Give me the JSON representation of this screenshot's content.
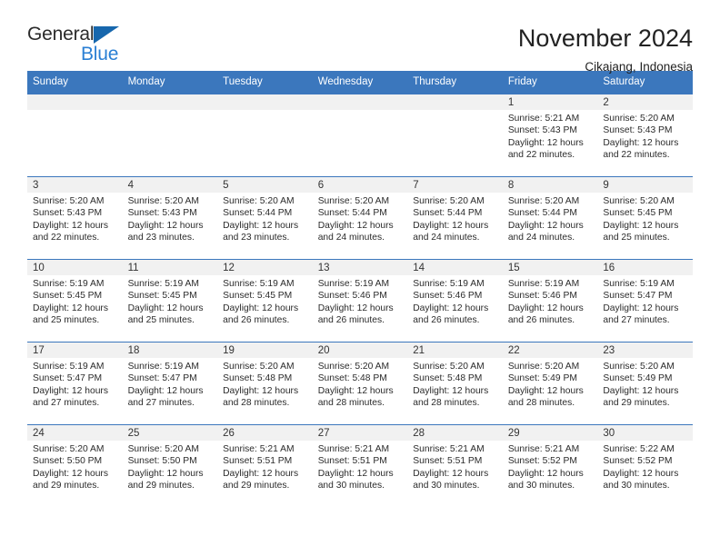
{
  "brand": {
    "name_part1": "General",
    "name_part2": "Blue",
    "triangle_icon": "triangle-icon",
    "colors": {
      "dark": "#2b2b2b",
      "blue": "#2a7fd4",
      "triangle": "#1767ad"
    }
  },
  "header": {
    "title": "November 2024",
    "location": "Cikajang, Indonesia"
  },
  "colors": {
    "header_blue": "#3b77bd",
    "daynum_band": "#f1f1f1",
    "cell_bg": "#ffffff",
    "text": "#2b2b2b"
  },
  "calendar": {
    "weekday_headers": [
      "Sunday",
      "Monday",
      "Tuesday",
      "Wednesday",
      "Thursday",
      "Friday",
      "Saturday"
    ],
    "weeks": [
      [
        {
          "empty": true,
          "day": ""
        },
        {
          "empty": true,
          "day": ""
        },
        {
          "empty": true,
          "day": ""
        },
        {
          "empty": true,
          "day": ""
        },
        {
          "empty": true,
          "day": ""
        },
        {
          "empty": false,
          "day": "1",
          "sunrise": "Sunrise: 5:21 AM",
          "sunset": "Sunset: 5:43 PM",
          "daylight1": "Daylight: 12 hours",
          "daylight2": "and 22 minutes."
        },
        {
          "empty": false,
          "day": "2",
          "sunrise": "Sunrise: 5:20 AM",
          "sunset": "Sunset: 5:43 PM",
          "daylight1": "Daylight: 12 hours",
          "daylight2": "and 22 minutes."
        }
      ],
      [
        {
          "empty": false,
          "day": "3",
          "sunrise": "Sunrise: 5:20 AM",
          "sunset": "Sunset: 5:43 PM",
          "daylight1": "Daylight: 12 hours",
          "daylight2": "and 22 minutes."
        },
        {
          "empty": false,
          "day": "4",
          "sunrise": "Sunrise: 5:20 AM",
          "sunset": "Sunset: 5:43 PM",
          "daylight1": "Daylight: 12 hours",
          "daylight2": "and 23 minutes."
        },
        {
          "empty": false,
          "day": "5",
          "sunrise": "Sunrise: 5:20 AM",
          "sunset": "Sunset: 5:44 PM",
          "daylight1": "Daylight: 12 hours",
          "daylight2": "and 23 minutes."
        },
        {
          "empty": false,
          "day": "6",
          "sunrise": "Sunrise: 5:20 AM",
          "sunset": "Sunset: 5:44 PM",
          "daylight1": "Daylight: 12 hours",
          "daylight2": "and 24 minutes."
        },
        {
          "empty": false,
          "day": "7",
          "sunrise": "Sunrise: 5:20 AM",
          "sunset": "Sunset: 5:44 PM",
          "daylight1": "Daylight: 12 hours",
          "daylight2": "and 24 minutes."
        },
        {
          "empty": false,
          "day": "8",
          "sunrise": "Sunrise: 5:20 AM",
          "sunset": "Sunset: 5:44 PM",
          "daylight1": "Daylight: 12 hours",
          "daylight2": "and 24 minutes."
        },
        {
          "empty": false,
          "day": "9",
          "sunrise": "Sunrise: 5:20 AM",
          "sunset": "Sunset: 5:45 PM",
          "daylight1": "Daylight: 12 hours",
          "daylight2": "and 25 minutes."
        }
      ],
      [
        {
          "empty": false,
          "day": "10",
          "sunrise": "Sunrise: 5:19 AM",
          "sunset": "Sunset: 5:45 PM",
          "daylight1": "Daylight: 12 hours",
          "daylight2": "and 25 minutes."
        },
        {
          "empty": false,
          "day": "11",
          "sunrise": "Sunrise: 5:19 AM",
          "sunset": "Sunset: 5:45 PM",
          "daylight1": "Daylight: 12 hours",
          "daylight2": "and 25 minutes."
        },
        {
          "empty": false,
          "day": "12",
          "sunrise": "Sunrise: 5:19 AM",
          "sunset": "Sunset: 5:45 PM",
          "daylight1": "Daylight: 12 hours",
          "daylight2": "and 26 minutes."
        },
        {
          "empty": false,
          "day": "13",
          "sunrise": "Sunrise: 5:19 AM",
          "sunset": "Sunset: 5:46 PM",
          "daylight1": "Daylight: 12 hours",
          "daylight2": "and 26 minutes."
        },
        {
          "empty": false,
          "day": "14",
          "sunrise": "Sunrise: 5:19 AM",
          "sunset": "Sunset: 5:46 PM",
          "daylight1": "Daylight: 12 hours",
          "daylight2": "and 26 minutes."
        },
        {
          "empty": false,
          "day": "15",
          "sunrise": "Sunrise: 5:19 AM",
          "sunset": "Sunset: 5:46 PM",
          "daylight1": "Daylight: 12 hours",
          "daylight2": "and 26 minutes."
        },
        {
          "empty": false,
          "day": "16",
          "sunrise": "Sunrise: 5:19 AM",
          "sunset": "Sunset: 5:47 PM",
          "daylight1": "Daylight: 12 hours",
          "daylight2": "and 27 minutes."
        }
      ],
      [
        {
          "empty": false,
          "day": "17",
          "sunrise": "Sunrise: 5:19 AM",
          "sunset": "Sunset: 5:47 PM",
          "daylight1": "Daylight: 12 hours",
          "daylight2": "and 27 minutes."
        },
        {
          "empty": false,
          "day": "18",
          "sunrise": "Sunrise: 5:19 AM",
          "sunset": "Sunset: 5:47 PM",
          "daylight1": "Daylight: 12 hours",
          "daylight2": "and 27 minutes."
        },
        {
          "empty": false,
          "day": "19",
          "sunrise": "Sunrise: 5:20 AM",
          "sunset": "Sunset: 5:48 PM",
          "daylight1": "Daylight: 12 hours",
          "daylight2": "and 28 minutes."
        },
        {
          "empty": false,
          "day": "20",
          "sunrise": "Sunrise: 5:20 AM",
          "sunset": "Sunset: 5:48 PM",
          "daylight1": "Daylight: 12 hours",
          "daylight2": "and 28 minutes."
        },
        {
          "empty": false,
          "day": "21",
          "sunrise": "Sunrise: 5:20 AM",
          "sunset": "Sunset: 5:48 PM",
          "daylight1": "Daylight: 12 hours",
          "daylight2": "and 28 minutes."
        },
        {
          "empty": false,
          "day": "22",
          "sunrise": "Sunrise: 5:20 AM",
          "sunset": "Sunset: 5:49 PM",
          "daylight1": "Daylight: 12 hours",
          "daylight2": "and 28 minutes."
        },
        {
          "empty": false,
          "day": "23",
          "sunrise": "Sunrise: 5:20 AM",
          "sunset": "Sunset: 5:49 PM",
          "daylight1": "Daylight: 12 hours",
          "daylight2": "and 29 minutes."
        }
      ],
      [
        {
          "empty": false,
          "day": "24",
          "sunrise": "Sunrise: 5:20 AM",
          "sunset": "Sunset: 5:50 PM",
          "daylight1": "Daylight: 12 hours",
          "daylight2": "and 29 minutes."
        },
        {
          "empty": false,
          "day": "25",
          "sunrise": "Sunrise: 5:20 AM",
          "sunset": "Sunset: 5:50 PM",
          "daylight1": "Daylight: 12 hours",
          "daylight2": "and 29 minutes."
        },
        {
          "empty": false,
          "day": "26",
          "sunrise": "Sunrise: 5:21 AM",
          "sunset": "Sunset: 5:51 PM",
          "daylight1": "Daylight: 12 hours",
          "daylight2": "and 29 minutes."
        },
        {
          "empty": false,
          "day": "27",
          "sunrise": "Sunrise: 5:21 AM",
          "sunset": "Sunset: 5:51 PM",
          "daylight1": "Daylight: 12 hours",
          "daylight2": "and 30 minutes."
        },
        {
          "empty": false,
          "day": "28",
          "sunrise": "Sunrise: 5:21 AM",
          "sunset": "Sunset: 5:51 PM",
          "daylight1": "Daylight: 12 hours",
          "daylight2": "and 30 minutes."
        },
        {
          "empty": false,
          "day": "29",
          "sunrise": "Sunrise: 5:21 AM",
          "sunset": "Sunset: 5:52 PM",
          "daylight1": "Daylight: 12 hours",
          "daylight2": "and 30 minutes."
        },
        {
          "empty": false,
          "day": "30",
          "sunrise": "Sunrise: 5:22 AM",
          "sunset": "Sunset: 5:52 PM",
          "daylight1": "Daylight: 12 hours",
          "daylight2": "and 30 minutes."
        }
      ]
    ]
  }
}
